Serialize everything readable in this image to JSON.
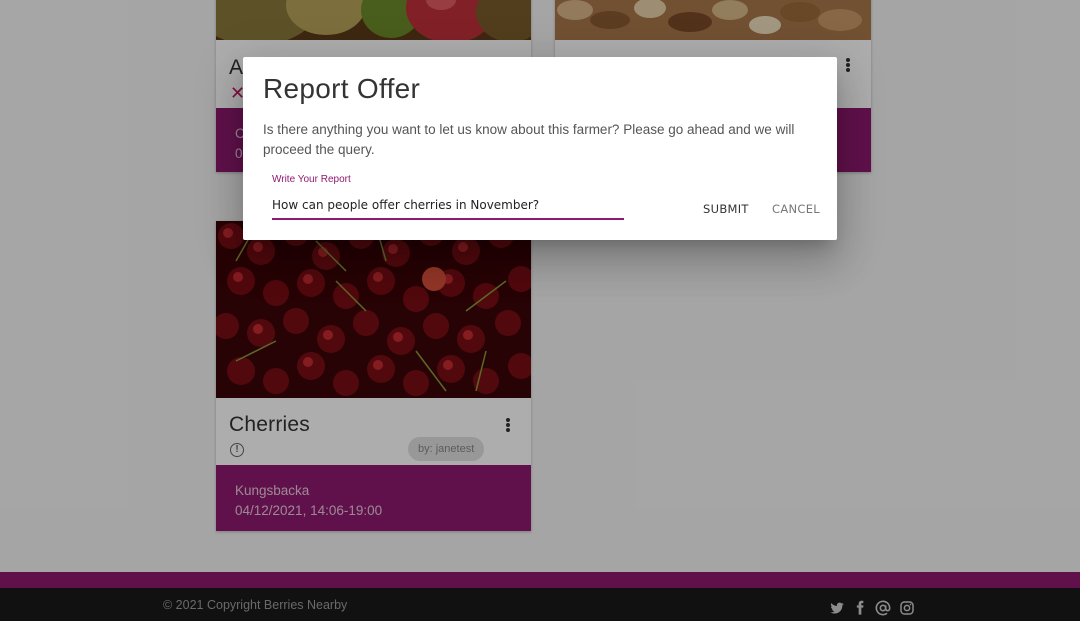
{
  "cards": {
    "top_left": {
      "title": "A",
      "close_glyph": "✕",
      "footer_location": "C",
      "footer_time": "0",
      "image": "fruit-image"
    },
    "top_right": {
      "image": "nuts-image",
      "menu_icon": "more-vertical-icon"
    },
    "cherries": {
      "title": "Cherries",
      "owner": "by: janetest",
      "footer_location": "Kungsbacka",
      "footer_time": "04/12/2021, 14:06-19:00",
      "info_glyph": "!",
      "image": "cherries-image",
      "menu_icon": "more-vertical-icon"
    }
  },
  "dialog": {
    "title": "Report Offer",
    "description": "Is there anything you want to let us know about this farmer? Please go ahead and we will proceed the query.",
    "field_label": "Write Your Report",
    "field_value": "How can people offer cherries in November?",
    "submit_label": "SUBMIT",
    "cancel_label": "CANCEL"
  },
  "footer": {
    "copyright": "© 2021 Copyright Berries Nearby",
    "social_icons": [
      "twitter-icon",
      "facebook-icon",
      "at-sign-icon",
      "instagram-icon"
    ]
  },
  "colors": {
    "accent": "#8e1a6f",
    "footer_dark": "#1a1a1a",
    "page_bg": "#f4f4f4"
  }
}
